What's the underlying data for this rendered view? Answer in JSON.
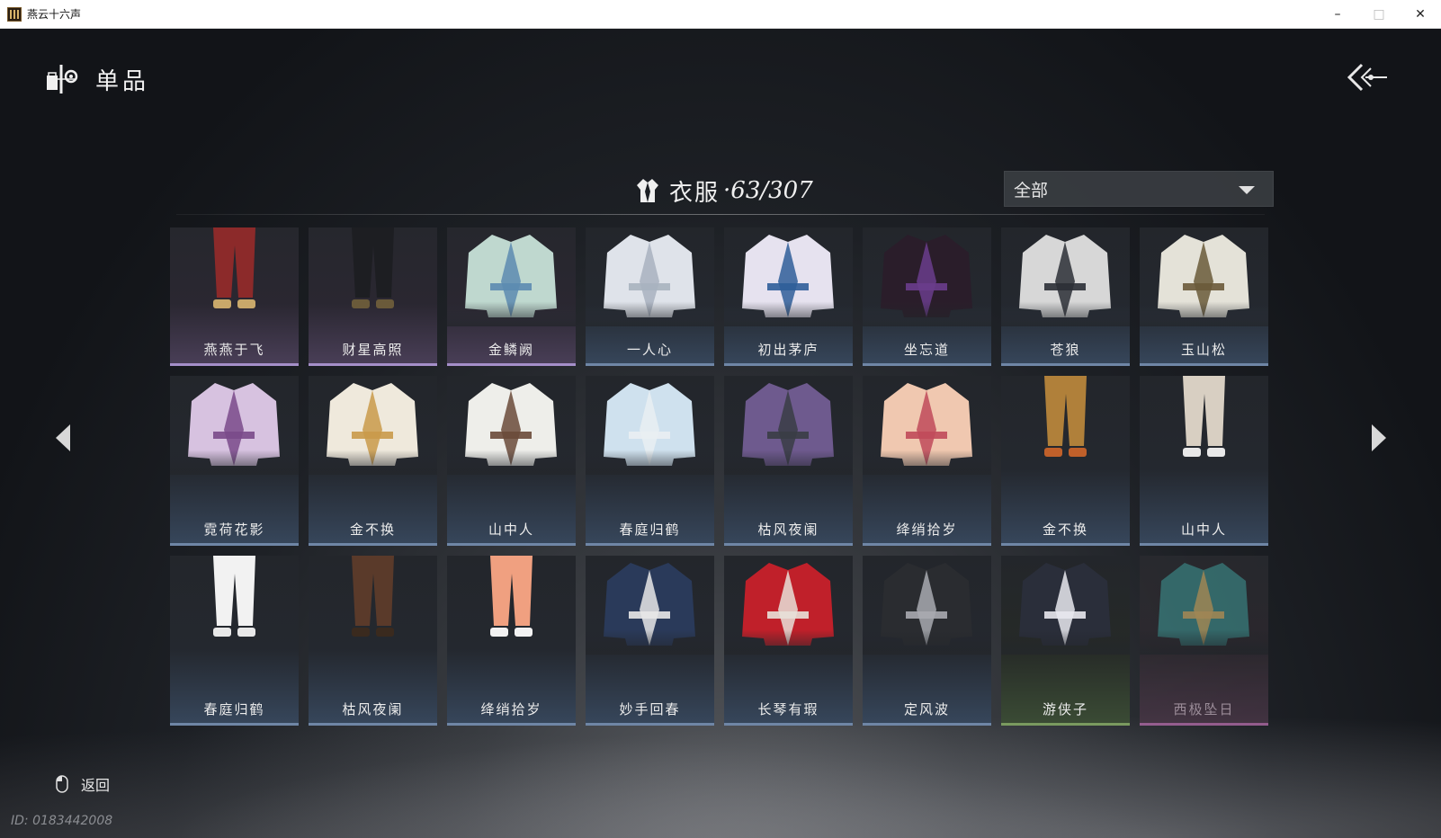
{
  "window": {
    "title": "燕云十六声",
    "controls": {
      "minimize": "–",
      "maximize": "□",
      "close": "✕"
    }
  },
  "header": {
    "title": "单品",
    "icon": "wardrobe-icon",
    "back_icon": "double-chevron-back-icon"
  },
  "category": {
    "label": "衣服",
    "count": "·63/307",
    "icon": "robe-icon"
  },
  "filter": {
    "selected": "全部",
    "icon": "caret-down-icon"
  },
  "items": [
    {
      "name": "燕燕于飞",
      "rarity": "purple"
    },
    {
      "name": "财星高照",
      "rarity": "purple"
    },
    {
      "name": "金鳞阙",
      "rarity": "purple"
    },
    {
      "name": "一人心",
      "rarity": "blue"
    },
    {
      "name": "初出茅庐",
      "rarity": "blue"
    },
    {
      "name": "坐忘道",
      "rarity": "blue"
    },
    {
      "name": "苍狼",
      "rarity": "blue"
    },
    {
      "name": "玉山松",
      "rarity": "blue"
    },
    {
      "name": "霓荷花影",
      "rarity": "blue"
    },
    {
      "name": "金不换",
      "rarity": "blue"
    },
    {
      "name": "山中人",
      "rarity": "blue"
    },
    {
      "name": "春庭归鹤",
      "rarity": "blue"
    },
    {
      "name": "枯风夜阑",
      "rarity": "blue"
    },
    {
      "name": "绛绡拾岁",
      "rarity": "blue"
    },
    {
      "name": "金不换",
      "rarity": "blue"
    },
    {
      "name": "山中人",
      "rarity": "blue"
    },
    {
      "name": "春庭归鹤",
      "rarity": "blue"
    },
    {
      "name": "枯风夜阑",
      "rarity": "blue"
    },
    {
      "name": "绛绡拾岁",
      "rarity": "blue"
    },
    {
      "name": "妙手回春",
      "rarity": "blue"
    },
    {
      "name": "长琴有瑕",
      "rarity": "blue"
    },
    {
      "name": "定风波",
      "rarity": "blue"
    },
    {
      "name": "游侠子",
      "rarity": "green"
    },
    {
      "name": "西极坠日",
      "rarity": "pink"
    }
  ],
  "rarity_colors": {
    "purple": "#a58fc9",
    "blue": "#6f86a6",
    "green": "#7a9a5f",
    "pink": "#b06aa6"
  },
  "nav": {
    "prev_icon": "arrow-left-icon",
    "next_icon": "arrow-right-icon"
  },
  "footer": {
    "back_label": "返回",
    "back_icon": "mouse-icon",
    "player_id": "ID: 0183442008"
  }
}
